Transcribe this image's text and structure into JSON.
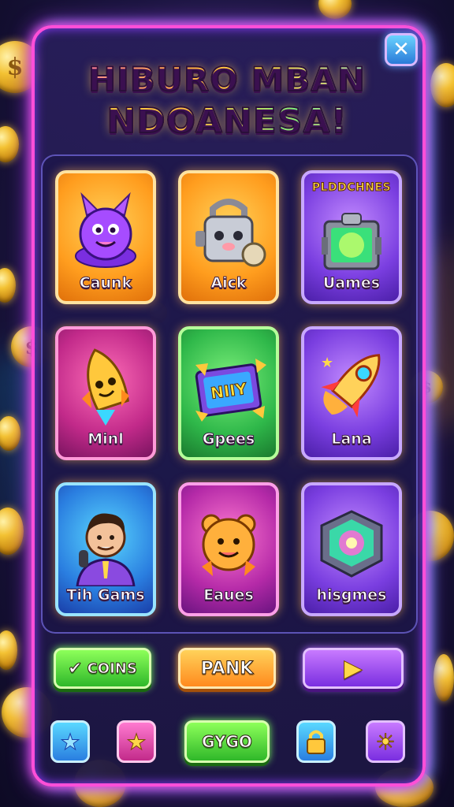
{
  "title": {
    "line1": "HIBURO MBAN",
    "line2": "NDOANESA!"
  },
  "close": {
    "glyph": "✕"
  },
  "cards": [
    {
      "label": "Caunk",
      "icon": "purple-monster-icon",
      "color": "orange"
    },
    {
      "label": "Aick",
      "icon": "robot-lock-icon",
      "color": "orange"
    },
    {
      "label": "Uames",
      "top_label": "PLDDCHNES",
      "icon": "treasure-chest-icon",
      "color": "purple"
    },
    {
      "label": "Minl",
      "icon": "rocket-character-icon",
      "color": "magenta"
    },
    {
      "label": "Gpees",
      "icon": "gift-box-icon",
      "box_text": "NIIY",
      "color": "green"
    },
    {
      "label": "Lana",
      "icon": "rocket-icon",
      "color": "purple"
    },
    {
      "label": "Tih Gams",
      "icon": "man-microphone-icon",
      "color": "blue"
    },
    {
      "label": "Eaues",
      "icon": "bear-icon",
      "color": "pink"
    },
    {
      "label": "hisgmes",
      "icon": "magic-cube-icon",
      "color": "purple"
    }
  ],
  "actions": {
    "coins_label": "COINS",
    "coins_check": "✔",
    "rank_label": "PANK",
    "play_glyph": "▶"
  },
  "bottom_bar": {
    "go_label": "GYGO",
    "star_glyph": "★",
    "sun_glyph": "☀"
  },
  "coin_symbol": "$"
}
